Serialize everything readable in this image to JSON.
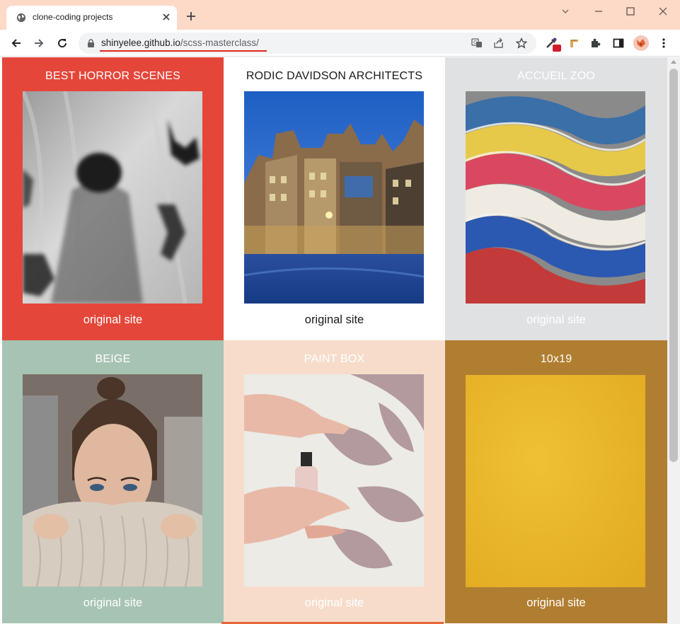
{
  "browser": {
    "tab_title": "clone-coding projects",
    "url_host": "shinyelee.github.io",
    "url_path": "/scss-masterclass/"
  },
  "projects": [
    {
      "title": "BEST HORROR SCENES",
      "link": "original site",
      "bg": "#e5463a",
      "text_color": "#ffffff"
    },
    {
      "title": "RODIC DAVIDSON ARCHITECTS",
      "link": "original site",
      "bg": "#ffffff",
      "text_color": "#1a1a1a"
    },
    {
      "title": "ACCUEIL ZOO",
      "link": "original site",
      "bg": "#e0e1e3",
      "text_color": "#ffffff"
    },
    {
      "title": "BEIGE",
      "link": "original site",
      "bg": "#a7c3b4",
      "text_color": "#ffffff"
    },
    {
      "title": "PAINT BOX",
      "link": "original site",
      "bg": "#f7dccb",
      "text_color": "#ffffff"
    },
    {
      "title": "10x19",
      "link": "original site",
      "bg": "#b07e31",
      "text_color": "#ffffff"
    }
  ],
  "icons": {
    "tab": "globe-icon",
    "toolbar": [
      "back-icon",
      "forward-icon",
      "reload-icon",
      "lock-icon",
      "translate-icon",
      "share-icon",
      "star-icon",
      "eyedropper-icon",
      "ruler-icon",
      "puzzle-icon",
      "sidepanel-icon",
      "avatar",
      "more-icon"
    ]
  }
}
